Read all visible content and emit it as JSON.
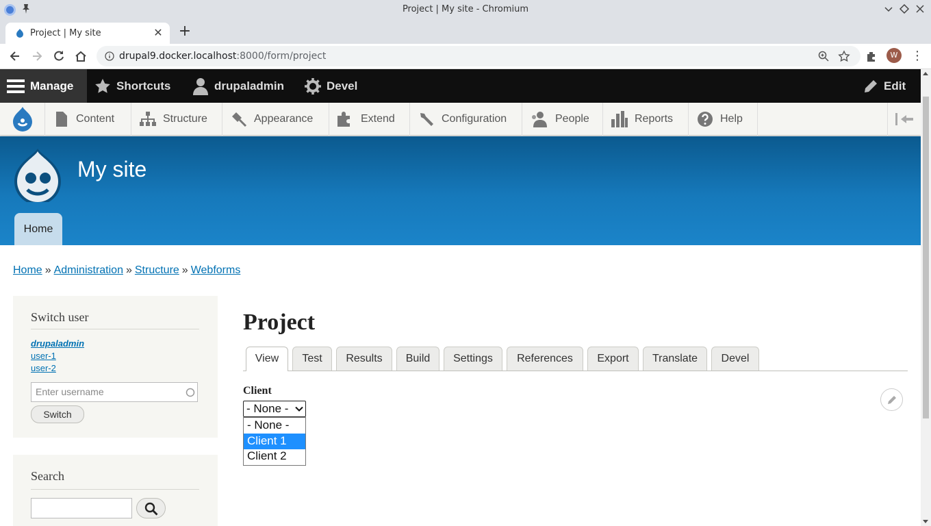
{
  "window": {
    "title": "Project | My site - Chromium"
  },
  "browser": {
    "tab_title": "Project | My site",
    "url_host": "drupal9.docker.localhost",
    "url_rest": ":8000/form/project",
    "profile_initial": "W"
  },
  "admin_toolbar": {
    "manage": "Manage",
    "shortcuts": "Shortcuts",
    "user": "drupaladmin",
    "devel": "Devel",
    "edit": "Edit"
  },
  "tray": {
    "items": [
      {
        "label": "Content"
      },
      {
        "label": "Structure"
      },
      {
        "label": "Appearance"
      },
      {
        "label": "Extend"
      },
      {
        "label": "Configuration"
      },
      {
        "label": "People"
      },
      {
        "label": "Reports"
      },
      {
        "label": "Help"
      }
    ]
  },
  "site": {
    "name": "My site",
    "home_tab": "Home"
  },
  "breadcrumb": {
    "items": [
      "Home",
      "Administration",
      "Structure",
      "Webforms"
    ],
    "separator": "»"
  },
  "switch_user": {
    "title": "Switch user",
    "users": [
      "drupaladmin",
      "user-1",
      "user-2"
    ],
    "placeholder": "Enter username",
    "button": "Switch"
  },
  "search_block": {
    "title": "Search"
  },
  "page": {
    "title": "Project",
    "tabs": [
      "View",
      "Test",
      "Results",
      "Build",
      "Settings",
      "References",
      "Export",
      "Translate",
      "Devel"
    ],
    "active_tab": "View"
  },
  "form": {
    "client_label": "Client",
    "client_value": "- None -",
    "options": [
      "- None -",
      "Client 1",
      "Client 2"
    ],
    "highlighted_option": "Client 1"
  },
  "colors": {
    "admin_bar": "#0f0f0f",
    "header_blue": "#1679bb",
    "link": "#0071b3",
    "option_highlight": "#1e90ff"
  }
}
